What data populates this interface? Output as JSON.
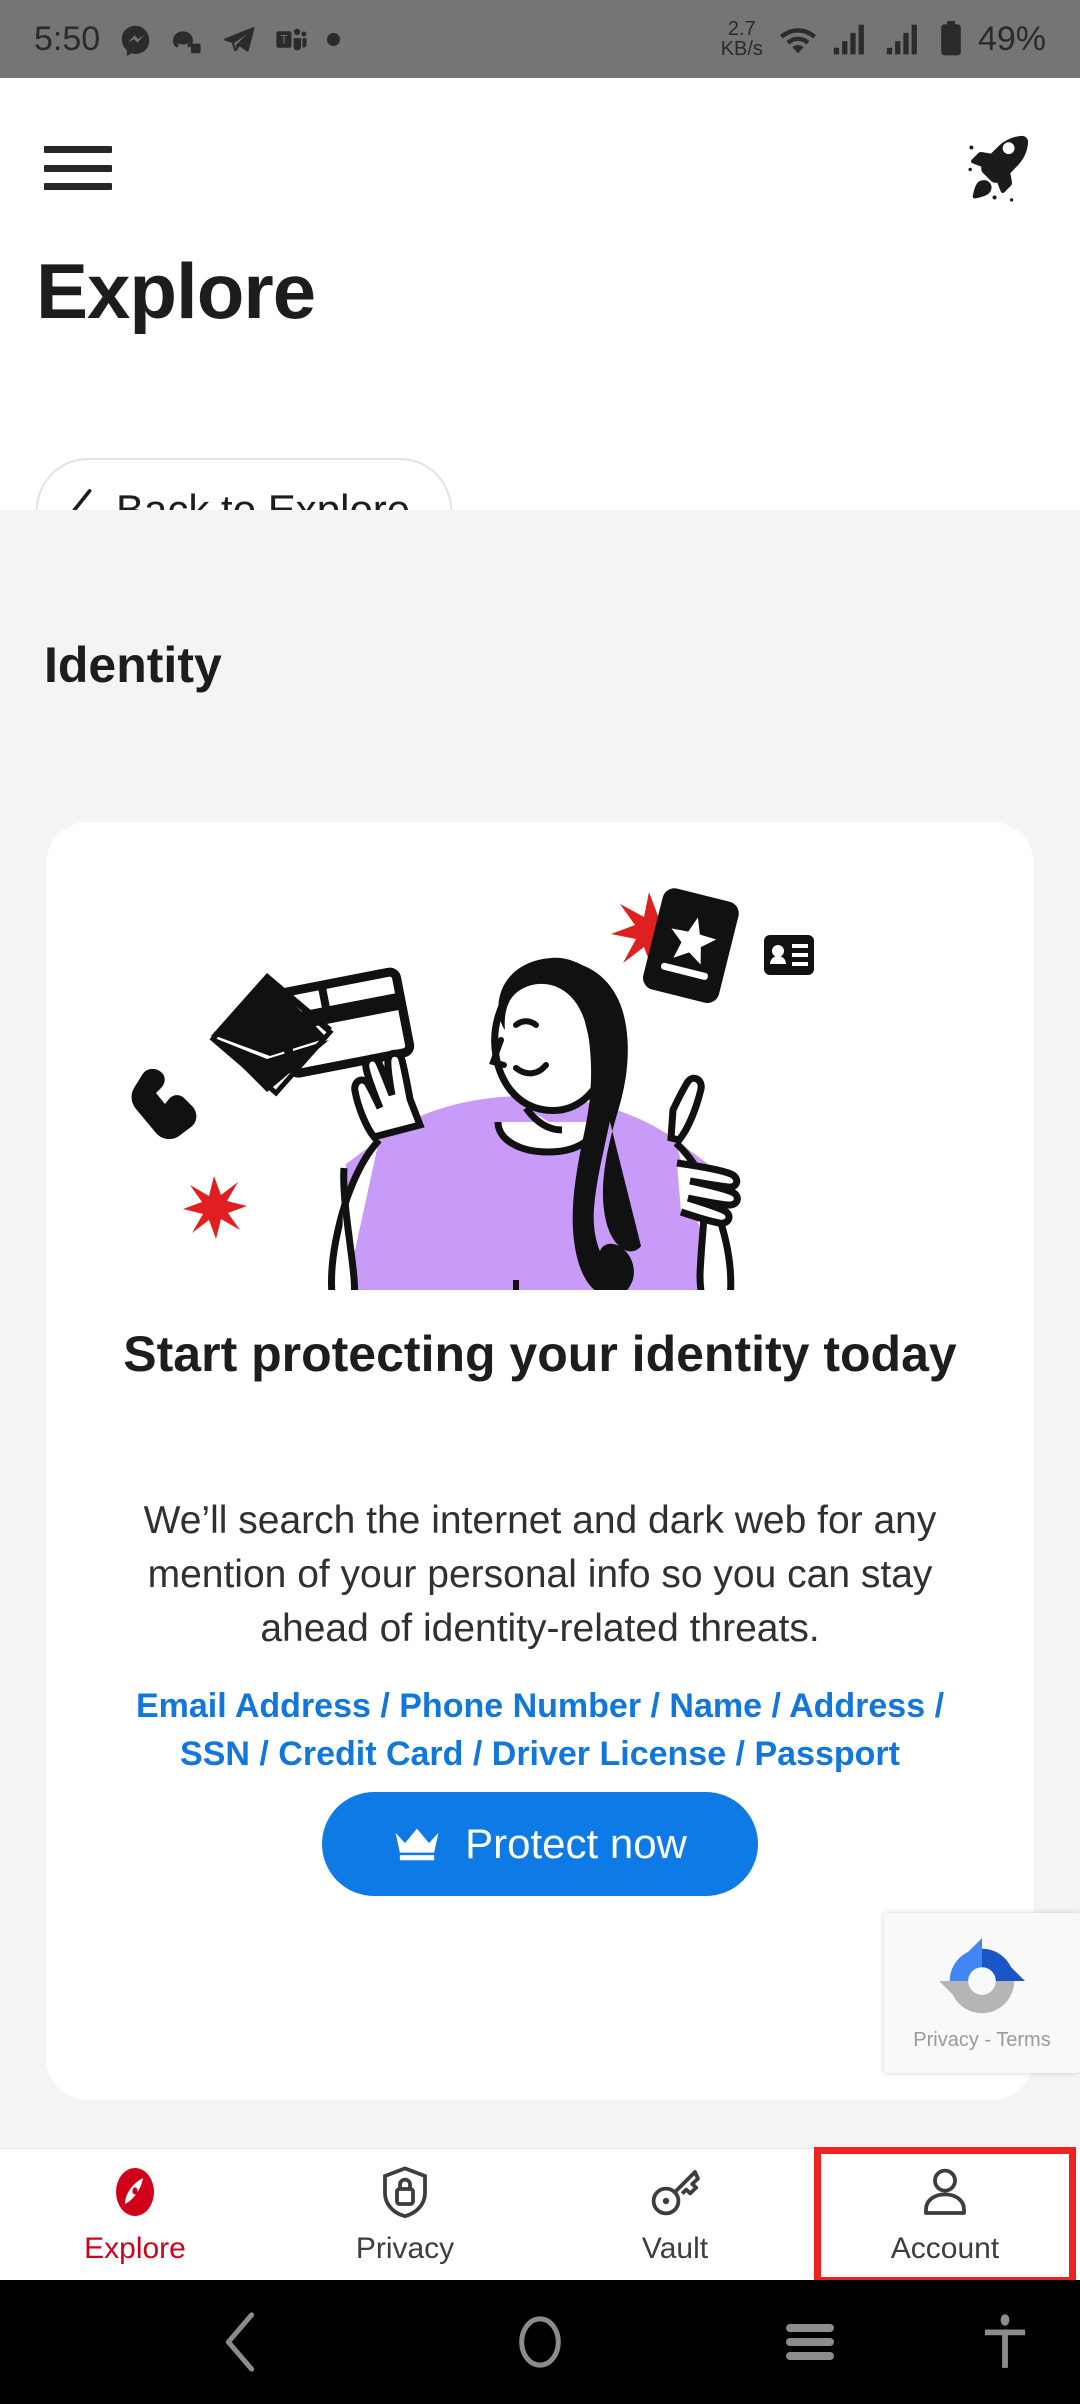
{
  "statusbar": {
    "time": "5:50",
    "tray_icons": [
      "messenger-icon",
      "discord-icon",
      "telegram-icon",
      "teams-icon",
      "notification-dot"
    ],
    "network_speed": "2.7",
    "network_speed_unit": "KB/s",
    "right_icons": [
      "wifi-icon",
      "signal-icon",
      "signal-icon",
      "battery-icon"
    ],
    "battery": "49%",
    "bg_color": "#757575"
  },
  "header": {
    "menu_icon": "hamburger-menu-icon",
    "rocket_icon": "rocket-icon",
    "title": "Explore",
    "back_button": {
      "label": "Back to Explore",
      "icon": "chevron-left-icon"
    }
  },
  "content": {
    "section_title": "Identity",
    "card": {
      "illustration": "identity-juggling-illustration",
      "heading": "Start protecting your identity today",
      "body": "We’ll search the internet and dark web for any mention of your personal info so you can stay ahead of identity-related threats.",
      "data_types": "Email Address / Phone Number / Name / Address / SSN / Credit Card / Driver License / Passport",
      "cta": {
        "label": "Protect now",
        "icon": "crown-icon",
        "color": "#0d7ae5"
      }
    }
  },
  "recaptcha": {
    "logo": "recaptcha-logo-icon",
    "text": "Privacy - Terms"
  },
  "bottomnav": {
    "items": [
      {
        "label": "Explore",
        "icon": "compass-icon",
        "active": true,
        "highlighted": false
      },
      {
        "label": "Privacy",
        "icon": "shield-lock-icon",
        "active": false,
        "highlighted": false
      },
      {
        "label": "Vault",
        "icon": "key-icon",
        "active": false,
        "highlighted": false
      },
      {
        "label": "Account",
        "icon": "person-icon",
        "active": false,
        "highlighted": true
      }
    ],
    "active_color": "#d0021b",
    "highlight_color": "#ef2222"
  },
  "androidnav": {
    "buttons": [
      "back-icon",
      "home-icon",
      "recents-icon",
      "accessibility-icon"
    ],
    "bg_color": "#000000"
  }
}
